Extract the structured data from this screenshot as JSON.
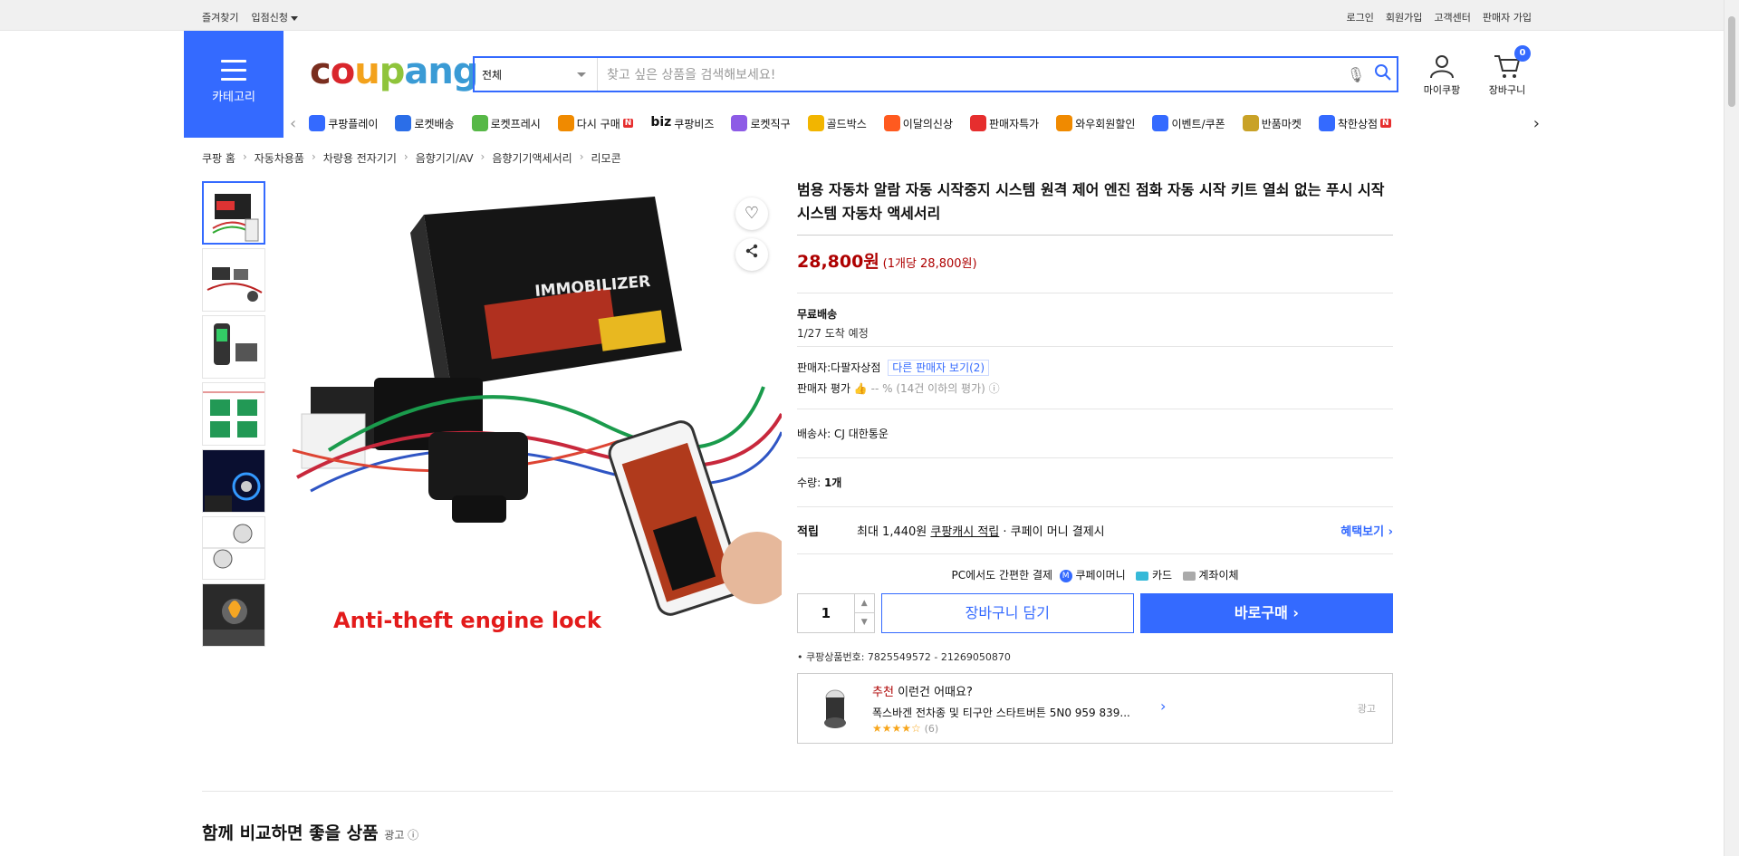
{
  "topbar": {
    "left": [
      "즐겨찾기",
      "입점신청"
    ],
    "right": [
      "로그인",
      "회원가입",
      "고객센터",
      "판매자 가입"
    ]
  },
  "header": {
    "category_label": "카테고리",
    "logo": [
      "c",
      "o",
      "u",
      "p",
      "ang"
    ],
    "search_category": "전체",
    "search_placeholder": "찾고 싶은 상품을 검색해보세요!",
    "mycoupang": "마이쿠팡",
    "cart": "장바구니",
    "cart_count": "0"
  },
  "nav": [
    {
      "label": "쿠팡플레이",
      "icon": "play-icon",
      "color": "#346aff"
    },
    {
      "label": "로켓배송",
      "icon": "rocket-icon",
      "color": "#2b6ee8"
    },
    {
      "label": "로켓프레시",
      "icon": "rocket-fresh-icon",
      "color": "#57b847"
    },
    {
      "label": "다시 구매",
      "icon": "rebuy-icon",
      "color": "#f08a00",
      "badge": "N"
    },
    {
      "label": "쿠팡비즈",
      "icon": "biz-icon",
      "color": "#111",
      "prefix": "biz"
    },
    {
      "label": "로켓직구",
      "icon": "global-icon",
      "color": "#8d5be6"
    },
    {
      "label": "골드박스",
      "icon": "goldbox-icon",
      "color": "#f2b500"
    },
    {
      "label": "이달의신상",
      "icon": "new-icon",
      "color": "#ff5a1f"
    },
    {
      "label": "판매자특가",
      "icon": "discount-icon",
      "color": "#e62e2e"
    },
    {
      "label": "와우회원할인",
      "icon": "wow-icon",
      "color": "#f08a00"
    },
    {
      "label": "이벤트/쿠폰",
      "icon": "coupon-icon",
      "color": "#346aff"
    },
    {
      "label": "반품마켓",
      "icon": "return-icon",
      "color": "#c9a227"
    },
    {
      "label": "착한상점",
      "icon": "good-store-icon",
      "color": "#346aff",
      "badge": "N"
    }
  ],
  "breadcrumb": [
    "쿠팡 홈",
    "자동차용품",
    "차량용 전자기기",
    "음향기기/AV",
    "음향기기액세서리",
    "리모콘"
  ],
  "product": {
    "title": "범용 자동차 알람 자동 시작중지 시스템 원격 제어 엔진 점화 자동 시작 키트 열쇠 없는 푸시 시작 시스템 자동차 액세서리",
    "price": "28,800원",
    "unit_price": "(1개당 28,800원)",
    "shipping_title": "무료배송",
    "shipping_date": "1/27 도착 예정",
    "seller_label": "판매자:",
    "seller_name": "다팔자상점",
    "other_sellers": "다른 판매자 보기(2)",
    "seller_rating_label": "판매자 평가",
    "seller_rating_value": "-- % (14건 이하의 평가)",
    "carrier_label": "배송사:",
    "carrier": "CJ 대한통운",
    "quantity_label": "수량:",
    "quantity_value": "1개",
    "reward_title": "적립",
    "reward_text": "최대 1,440원",
    "reward_link": "쿠팡캐시 적립",
    "reward_suffix": "· 쿠페이 머니 결제시",
    "reward_more": "혜택보기 ›",
    "pay_title": "PC에서도 간편한 결제",
    "pay_options": [
      "쿠페이머니",
      "카드",
      "계좌이체"
    ],
    "qty": "1",
    "cart_button": "장바구니 담기",
    "buy_button": "바로구매 ›",
    "product_no": "쿠팡상품번호: 7825549572 - 21269050870",
    "image_caption": "Anti-theft engine lock",
    "image_box_label": "IMMOBILIZER"
  },
  "recommend": {
    "head_red": "추천",
    "head": "이런건 어때요?",
    "name": "폭스바겐 전차종 및 티구안 스타트버튼 5N0 959 839...",
    "stars": "★★★★☆",
    "reviews": "(6)",
    "ad": "광고"
  },
  "compare": {
    "title": "함께 비교하면 좋을 상품",
    "ad": "광고 ⓘ"
  }
}
